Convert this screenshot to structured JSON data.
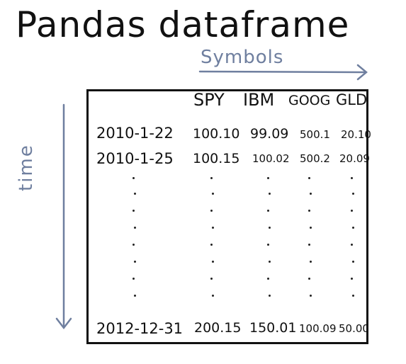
{
  "title": "Pandas dataframe",
  "axes": {
    "columns_label": "Symbols",
    "rows_label": "time"
  },
  "table": {
    "columns": [
      "SPY",
      "IBM",
      "GOOG",
      "GLD"
    ],
    "rows": [
      {
        "date": "2010-1-22",
        "values": [
          "100.10",
          "99.09",
          "500.1",
          "20.10"
        ]
      },
      {
        "date": "2010-1-25",
        "values": [
          "100.15",
          "100.02",
          "500.2",
          "20.09"
        ]
      },
      {
        "date": "2012-12-31",
        "values": [
          "200.15",
          "150.01",
          "100.09",
          "50.00"
        ]
      }
    ]
  },
  "colors": {
    "ink": "#111111",
    "annotation": "#6f7f9f"
  }
}
